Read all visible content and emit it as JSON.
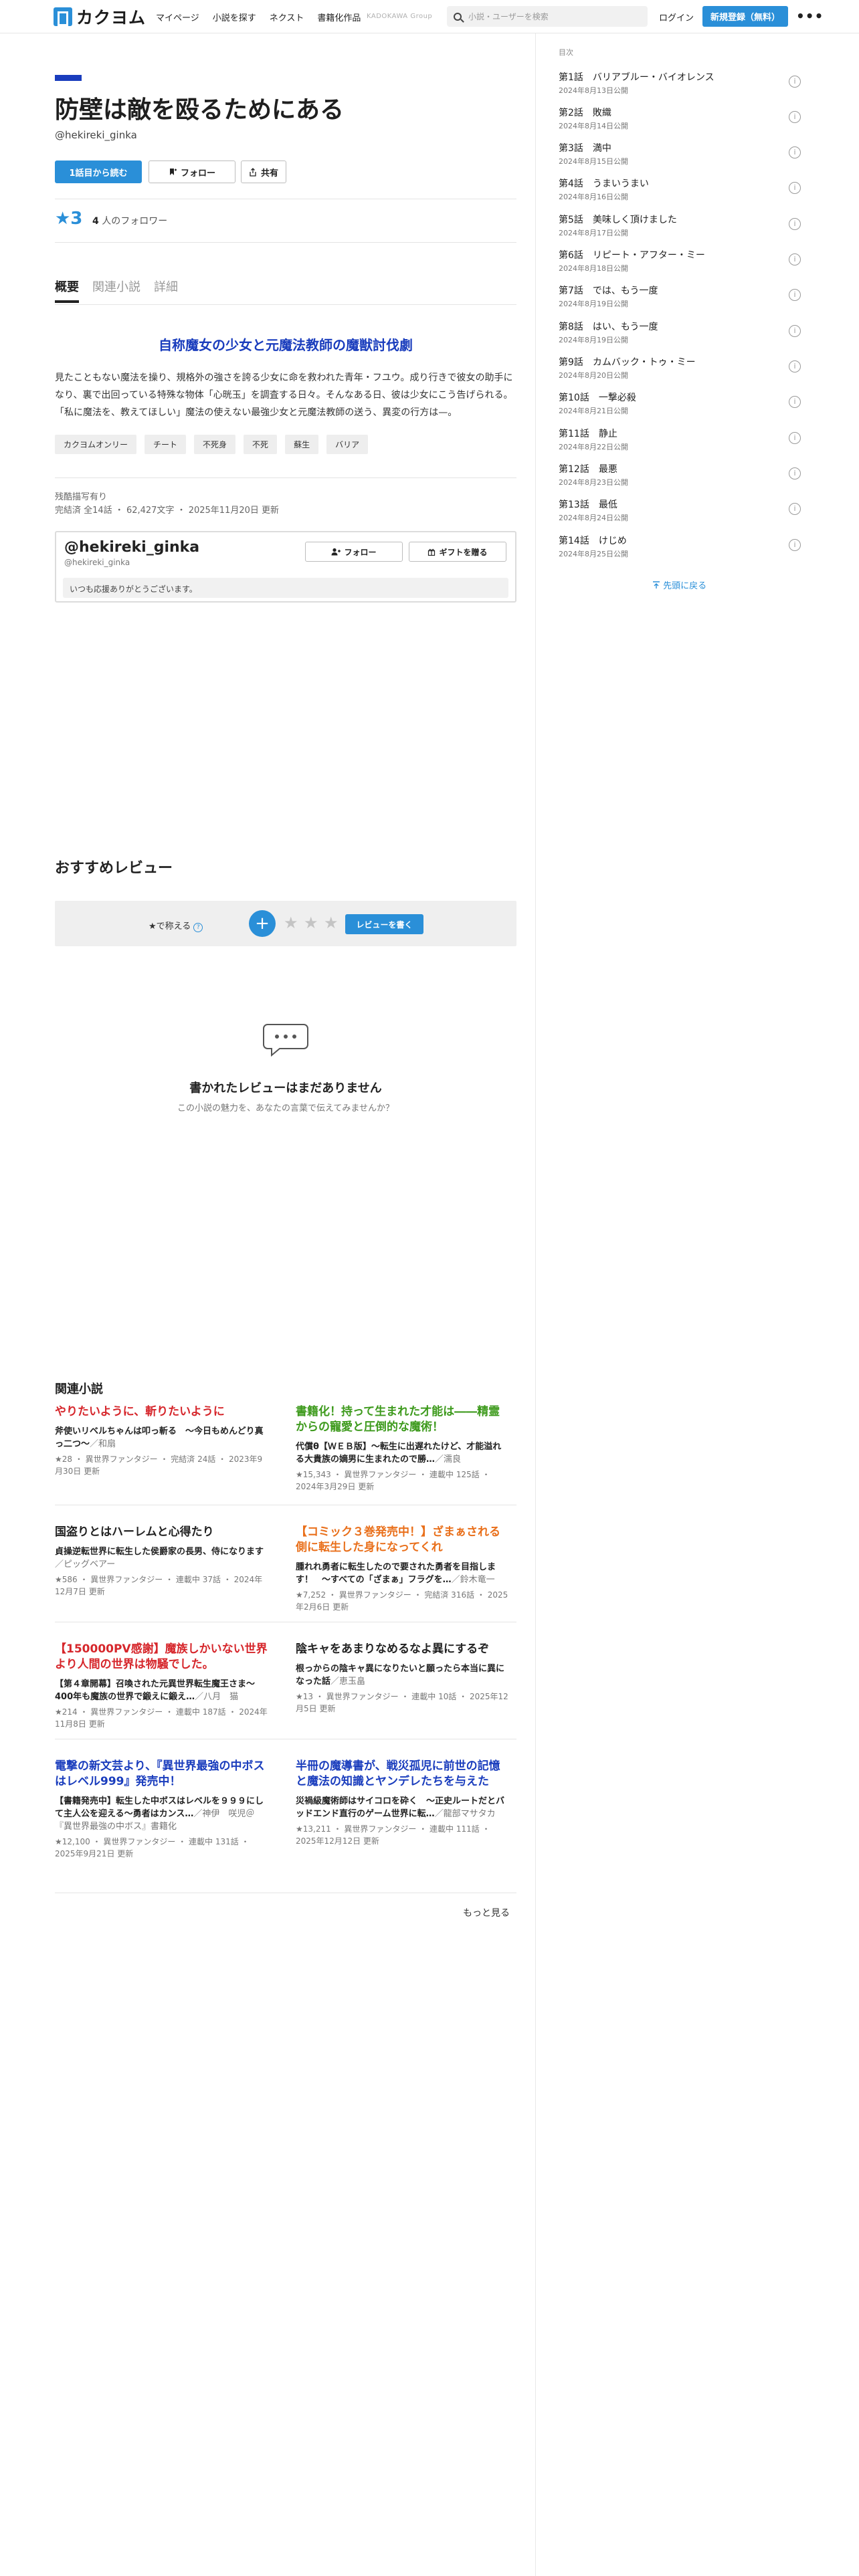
{
  "header": {
    "logo_text": "カクヨム",
    "nav": [
      "マイページ",
      "小説を探す",
      "ネクスト",
      "書籍化作品"
    ],
    "group_label": "KADOKAWA Group",
    "search_placeholder": "小説・ユーザーを検索",
    "login_label": "ログイン",
    "signup_label": "新規登録（無料）",
    "more_label": "•••"
  },
  "work": {
    "title": "防壁は敵を殴るためにある",
    "author": "@hekireki_ginka",
    "read_first_label": "1話目から読む",
    "follow_label": "フォロー",
    "share_label": "共有",
    "stars": "★3",
    "followers_count": "4",
    "followers_suffix": "人のフォロワー",
    "tabs": [
      "概要",
      "関連小説",
      "詳細"
    ],
    "catchphrase": "自称魔女の少女と元魔法教師の魔獣討伐劇",
    "intro": "見たこともない魔法を操り、規格外の強さを誇る少女に命を救われた青年・フユウ。成り行きで彼女の助手になり、裏で出回っている特殊な物体「心晄玉」を調査する日々。そんなある日、彼は少女にこう告げられる。「私に魔法を、教えてほしい」魔法の使えない最強少女と元魔法教師の送う、異変の行方は—。",
    "tags": [
      "カクヨムオンリー",
      "チート",
      "不死身",
      "不死",
      "蘇生",
      "バリア"
    ],
    "meta_line1": "残酷描写有り",
    "meta_line2": "完結済 全14話 ・ 62,427文字 ・ 2025年11月20日 更新"
  },
  "author_box": {
    "name": "@hekireki_ginka",
    "id": "@hekireki_ginka",
    "follow_label": "フォロー",
    "gift_label": "ギフトを贈る",
    "message": "いつも応援ありがとうございます。"
  },
  "reviews": {
    "section_title": "おすすめレビュー",
    "rate_label": "★で称える",
    "rate_help": "?",
    "plus_label": "+",
    "write_label": "レビューを書く",
    "empty_title": "書かれたレビューはまだありません",
    "empty_sub": "この小説の魅力を、あなたの言葉で伝えてみませんか？"
  },
  "related": {
    "section_title": "関連小説",
    "more_label": "もっと見る",
    "items": [
      {
        "catch": "やりたいように、斬りたいように",
        "color": "#d6262b",
        "title": "斧使いリベルちゃんは叩っ斬る　〜今日もめんどり真っ二つ〜",
        "author": "／和扇",
        "meta": "★28 ・ 異世界ファンタジー ・ 完結済 24話 ・ 2023年9月30日 更新"
      },
      {
        "catch": "書籍化！持って生まれた才能は――精霊からの寵愛と圧倒的な魔術！",
        "color": "#3d9a1c",
        "title": "代償θ【ＷＥＢ版】〜転生に出遅れたけど、才能溢れる大貴族の嫡男に生まれたので勝…",
        "author": "／濡良",
        "meta": "★15,343 ・ 異世界ファンタジー ・ 連載中 125話 ・ 2024年3月29日 更新"
      },
      {
        "catch": "国盗りとはハーレムと心得たり",
        "color": "#222222",
        "title": "貞操逆転世界に転生した侯爵家の長男、侍になります",
        "author": "／ピッグベアー",
        "meta": "★586 ・ 異世界ファンタジー ・ 連載中 37話 ・ 2024年12月7日 更新"
      },
      {
        "catch": "【コミック３巻発売中！】ざまぁされる側に転生した身になってくれ",
        "color": "#e96f1a",
        "title": "腫れれ勇者に転生したので要された勇者を目指します！　〜すべての「ざまぁ」フラグを…",
        "author": "／鈴木竜一",
        "meta": "★7,252 ・ 異世界ファンタジー ・ 完結済 316話 ・ 2025年2月6日 更新"
      },
      {
        "catch": "【150000PV感謝】魔族しかいない世界より人間の世界は物騒でした。",
        "color": "#d6262b",
        "title": "【第４章開幕】召喚された元異世界転生魔王さま〜400年も魔族の世界で鍛えに鍛え…",
        "author": "／八月　猫",
        "meta": "★214 ・ 異世界ファンタジー ・ 連載中 187話 ・ 2024年11月8日 更新"
      },
      {
        "catch": "陰キャをあまりなめるなよ異にするぞ",
        "color": "#222222",
        "title": "根っからの陰キャ異になりたいと願ったら本当に異になった話",
        "author": "／恵玉畠",
        "meta": "★13 ・ 異世界ファンタジー ・ 連載中 10話 ・ 2025年12月5日 更新"
      },
      {
        "catch": "電撃の新文芸より、『異世界最強の中ボスはレベル999』発売中！",
        "color": "#1a3dbd",
        "title": "【書籍発売中】転生した中ボスはレベルを９９９にして主人公を迎える〜勇者はカンス…",
        "author": "／神伊　咲児＠『異世界最強の中ボス』書籍化",
        "meta": "★12,100 ・ 異世界ファンタジー ・ 連載中 131話 ・ 2025年9月21日 更新"
      },
      {
        "catch": "半冊の魔導書が、戦災孤児に前世の記憶と魔法の知識とヤンデレたちを与えた",
        "color": "#1a3dbd",
        "title": "災禍級魔術師はサイコロを砕く　〜正史ルートだとバッドエンド直行のゲーム世界に転…",
        "author": "／龍部マサタカ",
        "meta": "★13,211 ・ 異世界ファンタジー ・ 連載中 111話 ・ 2025年12月12日 更新"
      }
    ]
  },
  "toc": {
    "label": "目次",
    "to_top_label": "先頭に戻る",
    "info_icon": "i",
    "episodes": [
      {
        "title": "第1話　バリアブルー・バイオレンス",
        "date": "2024年8月13日公開"
      },
      {
        "title": "第2話　敗織",
        "date": "2024年8月14日公開"
      },
      {
        "title": "第3話　満中",
        "date": "2024年8月15日公開"
      },
      {
        "title": "第4話　うまいうまい",
        "date": "2024年8月16日公開"
      },
      {
        "title": "第5話　美味しく頂けました",
        "date": "2024年8月17日公開"
      },
      {
        "title": "第6話　リピート・アフター・ミー",
        "date": "2024年8月18日公開"
      },
      {
        "title": "第7話　では、もう一度",
        "date": "2024年8月19日公開"
      },
      {
        "title": "第8話　はい、もう一度",
        "date": "2024年8月19日公開"
      },
      {
        "title": "第9話　カムバック・トゥ・ミー",
        "date": "2024年8月20日公開"
      },
      {
        "title": "第10話　一撃必殺",
        "date": "2024年8月21日公開"
      },
      {
        "title": "第11話　静止",
        "date": "2024年8月22日公開"
      },
      {
        "title": "第12話　最悪",
        "date": "2024年8月23日公開"
      },
      {
        "title": "第13話　最低",
        "date": "2024年8月24日公開"
      },
      {
        "title": "第14話　けじめ",
        "date": "2024年8月25日公開"
      }
    ]
  }
}
